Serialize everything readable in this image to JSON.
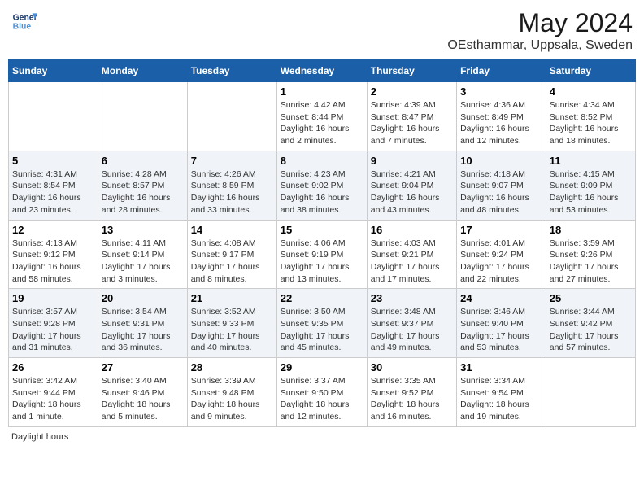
{
  "header": {
    "logo_line1": "General",
    "logo_line2": "Blue",
    "title": "May 2024",
    "subtitle": "OEsthammar, Uppsala, Sweden"
  },
  "days_of_week": [
    "Sunday",
    "Monday",
    "Tuesday",
    "Wednesday",
    "Thursday",
    "Friday",
    "Saturday"
  ],
  "weeks": [
    [
      {
        "day": "",
        "info": ""
      },
      {
        "day": "",
        "info": ""
      },
      {
        "day": "",
        "info": ""
      },
      {
        "day": "1",
        "info": "Sunrise: 4:42 AM\nSunset: 8:44 PM\nDaylight: 16 hours\nand 2 minutes."
      },
      {
        "day": "2",
        "info": "Sunrise: 4:39 AM\nSunset: 8:47 PM\nDaylight: 16 hours\nand 7 minutes."
      },
      {
        "day": "3",
        "info": "Sunrise: 4:36 AM\nSunset: 8:49 PM\nDaylight: 16 hours\nand 12 minutes."
      },
      {
        "day": "4",
        "info": "Sunrise: 4:34 AM\nSunset: 8:52 PM\nDaylight: 16 hours\nand 18 minutes."
      }
    ],
    [
      {
        "day": "5",
        "info": "Sunrise: 4:31 AM\nSunset: 8:54 PM\nDaylight: 16 hours\nand 23 minutes."
      },
      {
        "day": "6",
        "info": "Sunrise: 4:28 AM\nSunset: 8:57 PM\nDaylight: 16 hours\nand 28 minutes."
      },
      {
        "day": "7",
        "info": "Sunrise: 4:26 AM\nSunset: 8:59 PM\nDaylight: 16 hours\nand 33 minutes."
      },
      {
        "day": "8",
        "info": "Sunrise: 4:23 AM\nSunset: 9:02 PM\nDaylight: 16 hours\nand 38 minutes."
      },
      {
        "day": "9",
        "info": "Sunrise: 4:21 AM\nSunset: 9:04 PM\nDaylight: 16 hours\nand 43 minutes."
      },
      {
        "day": "10",
        "info": "Sunrise: 4:18 AM\nSunset: 9:07 PM\nDaylight: 16 hours\nand 48 minutes."
      },
      {
        "day": "11",
        "info": "Sunrise: 4:15 AM\nSunset: 9:09 PM\nDaylight: 16 hours\nand 53 minutes."
      }
    ],
    [
      {
        "day": "12",
        "info": "Sunrise: 4:13 AM\nSunset: 9:12 PM\nDaylight: 16 hours\nand 58 minutes."
      },
      {
        "day": "13",
        "info": "Sunrise: 4:11 AM\nSunset: 9:14 PM\nDaylight: 17 hours\nand 3 minutes."
      },
      {
        "day": "14",
        "info": "Sunrise: 4:08 AM\nSunset: 9:17 PM\nDaylight: 17 hours\nand 8 minutes."
      },
      {
        "day": "15",
        "info": "Sunrise: 4:06 AM\nSunset: 9:19 PM\nDaylight: 17 hours\nand 13 minutes."
      },
      {
        "day": "16",
        "info": "Sunrise: 4:03 AM\nSunset: 9:21 PM\nDaylight: 17 hours\nand 17 minutes."
      },
      {
        "day": "17",
        "info": "Sunrise: 4:01 AM\nSunset: 9:24 PM\nDaylight: 17 hours\nand 22 minutes."
      },
      {
        "day": "18",
        "info": "Sunrise: 3:59 AM\nSunset: 9:26 PM\nDaylight: 17 hours\nand 27 minutes."
      }
    ],
    [
      {
        "day": "19",
        "info": "Sunrise: 3:57 AM\nSunset: 9:28 PM\nDaylight: 17 hours\nand 31 minutes."
      },
      {
        "day": "20",
        "info": "Sunrise: 3:54 AM\nSunset: 9:31 PM\nDaylight: 17 hours\nand 36 minutes."
      },
      {
        "day": "21",
        "info": "Sunrise: 3:52 AM\nSunset: 9:33 PM\nDaylight: 17 hours\nand 40 minutes."
      },
      {
        "day": "22",
        "info": "Sunrise: 3:50 AM\nSunset: 9:35 PM\nDaylight: 17 hours\nand 45 minutes."
      },
      {
        "day": "23",
        "info": "Sunrise: 3:48 AM\nSunset: 9:37 PM\nDaylight: 17 hours\nand 49 minutes."
      },
      {
        "day": "24",
        "info": "Sunrise: 3:46 AM\nSunset: 9:40 PM\nDaylight: 17 hours\nand 53 minutes."
      },
      {
        "day": "25",
        "info": "Sunrise: 3:44 AM\nSunset: 9:42 PM\nDaylight: 17 hours\nand 57 minutes."
      }
    ],
    [
      {
        "day": "26",
        "info": "Sunrise: 3:42 AM\nSunset: 9:44 PM\nDaylight: 18 hours\nand 1 minute."
      },
      {
        "day": "27",
        "info": "Sunrise: 3:40 AM\nSunset: 9:46 PM\nDaylight: 18 hours\nand 5 minutes."
      },
      {
        "day": "28",
        "info": "Sunrise: 3:39 AM\nSunset: 9:48 PM\nDaylight: 18 hours\nand 9 minutes."
      },
      {
        "day": "29",
        "info": "Sunrise: 3:37 AM\nSunset: 9:50 PM\nDaylight: 18 hours\nand 12 minutes."
      },
      {
        "day": "30",
        "info": "Sunrise: 3:35 AM\nSunset: 9:52 PM\nDaylight: 18 hours\nand 16 minutes."
      },
      {
        "day": "31",
        "info": "Sunrise: 3:34 AM\nSunset: 9:54 PM\nDaylight: 18 hours\nand 19 minutes."
      },
      {
        "day": "",
        "info": ""
      }
    ]
  ],
  "footer_label": "Daylight hours"
}
